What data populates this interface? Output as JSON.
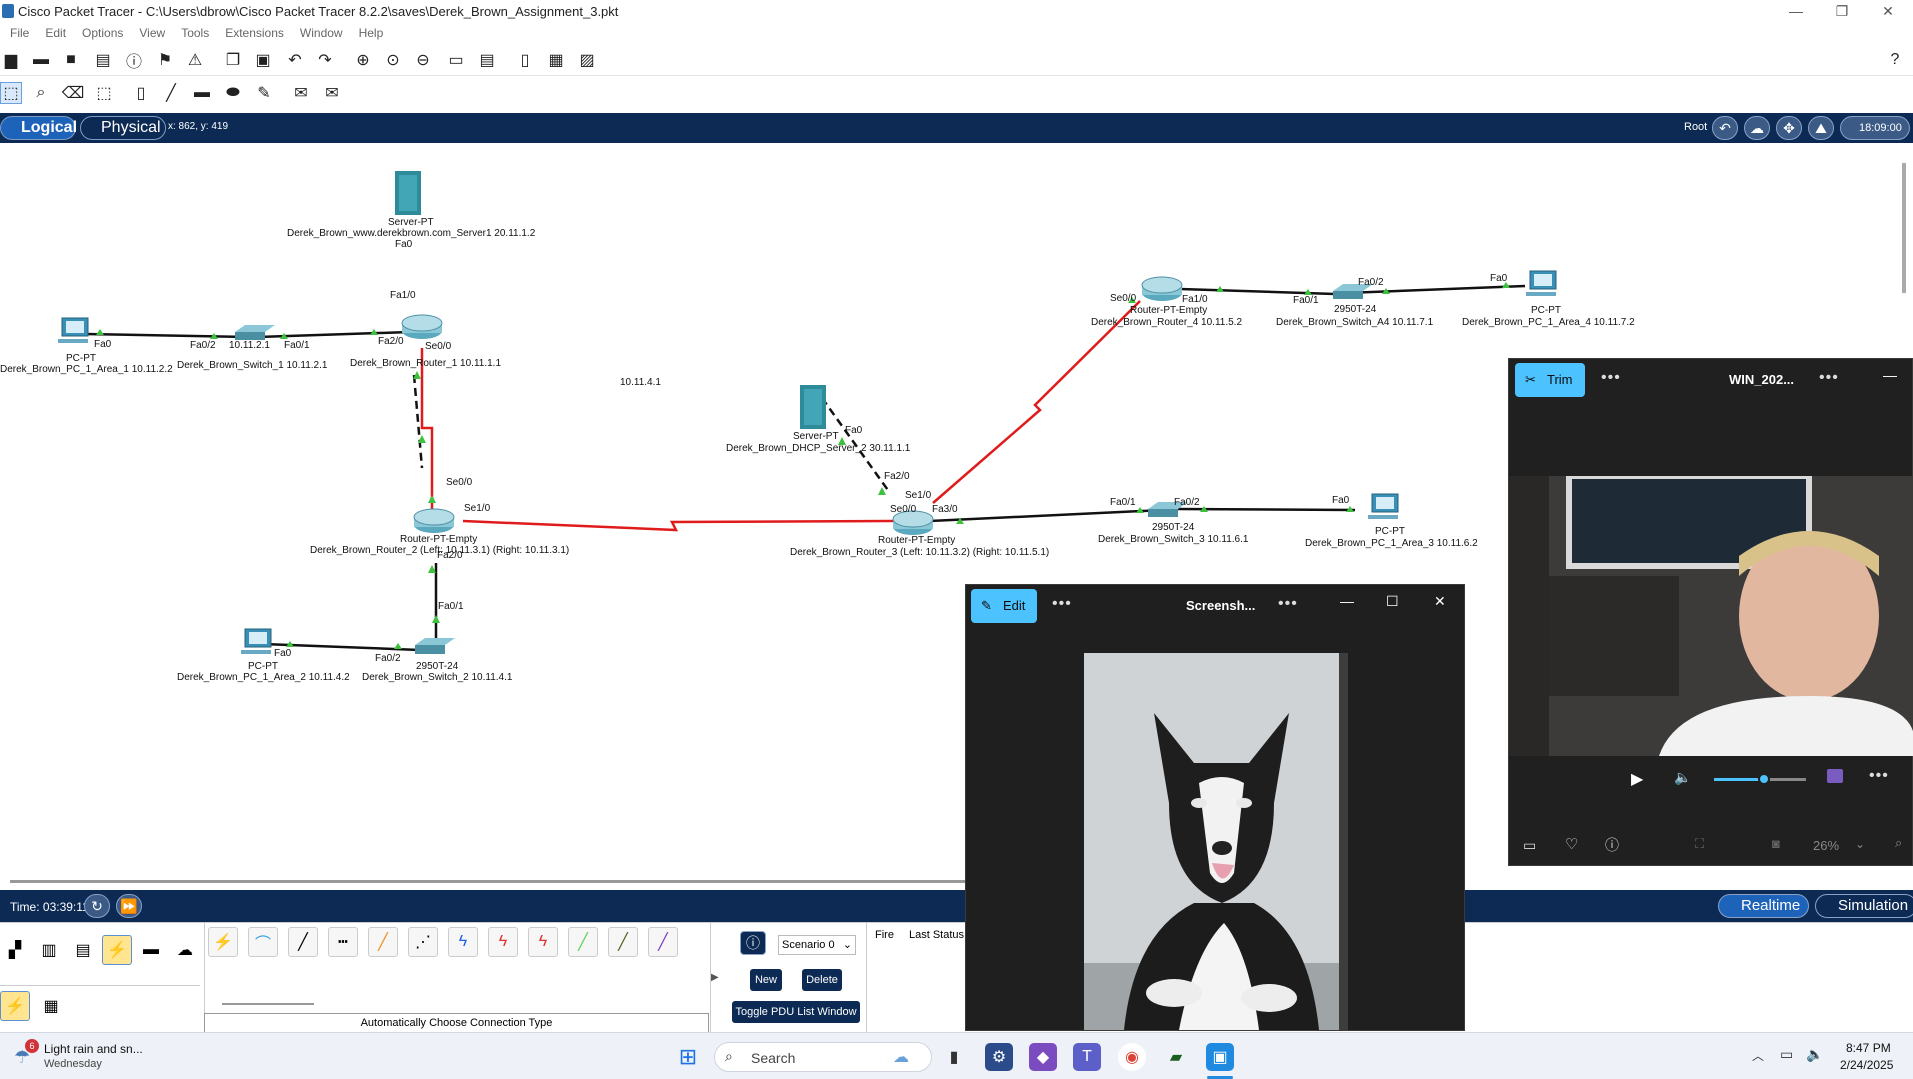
{
  "window": {
    "title": "Cisco Packet Tracer - C:\\Users\\dbrow\\Cisco Packet Tracer 8.2.2\\saves\\Derek_Brown_Assignment_3.pkt",
    "minimize": "—",
    "maximize": "❐",
    "close": "✕"
  },
  "menu": [
    "File",
    "Edit",
    "Options",
    "View",
    "Tools",
    "Extensions",
    "Window",
    "Help"
  ],
  "nav": {
    "logical": "Logical",
    "physical": "Physical",
    "coords": "x: 862, y: 419",
    "root": "Root",
    "time": "18:09:00"
  },
  "topology": {
    "free_label": "10.11.4.1",
    "devices": [
      {
        "id": "server1",
        "type": "Server-PT",
        "name": "Derek_Brown_www.derekbrown.com_Server1 20.11.1.2"
      },
      {
        "id": "router1",
        "type": "Router-PT-Empty",
        "name": "Derek_Brown_Router_1 10.11.1.1"
      },
      {
        "id": "switch1",
        "type": "2950T-24",
        "ip": "10.11.2.1",
        "name": "Derek_Brown_Switch_1 10.11.2.1"
      },
      {
        "id": "pc1",
        "type": "PC-PT",
        "name": "Derek_Brown_PC_1_Area_1 10.11.2.2"
      },
      {
        "id": "router2",
        "type": "Router-PT-Empty",
        "name": "Derek_Brown_Router_2 (Left: 10.11.3.1) (Right: 10.11.3.1)"
      },
      {
        "id": "switch2",
        "type": "2950T-24",
        "name": "Derek_Brown_Switch_2 10.11.4.1"
      },
      {
        "id": "pc2",
        "type": "PC-PT",
        "name": "Derek_Brown_PC_1_Area_2 10.11.4.2"
      },
      {
        "id": "server2",
        "type": "Server-PT",
        "name": "Derek_Brown_DHCP_Server_2 30.11.1.1"
      },
      {
        "id": "router3",
        "type": "Router-PT-Empty",
        "name": "Derek_Brown_Router_3 (Left: 10.11.3.2) (Right: 10.11.5.1)"
      },
      {
        "id": "switch3",
        "type": "2950T-24",
        "name": "Derek_Brown_Switch_3 10.11.6.1"
      },
      {
        "id": "pc3",
        "type": "PC-PT",
        "name": "Derek_Brown_PC_1_Area_3 10.11.6.2"
      },
      {
        "id": "router4",
        "type": "Router-PT-Empty",
        "name": "Derek_Brown_Router_4 10.11.5.2"
      },
      {
        "id": "switch4",
        "type": "2950T-24",
        "name": "Derek_Brown_Switch_A4 10.11.7.1"
      },
      {
        "id": "pc4",
        "type": "PC-PT",
        "name": "Derek_Brown_PC_1_Area_4 10.11.7.2"
      }
    ],
    "ports": [
      "Fa0",
      "Fa1/0",
      "Se0/0",
      "Fa2/0",
      "Fa0/1",
      "Fa0/2",
      "Se1/0",
      "Fa3/0"
    ]
  },
  "sim": {
    "time": "Time: 03:39:11",
    "realtime": "Realtime",
    "simulation": "Simulation"
  },
  "bottom": {
    "connection_type": "Automatically Choose Connection Type",
    "scenario": "Scenario 0",
    "new": "New",
    "delete": "Delete",
    "toggle_pdu": "Toggle PDU List Window",
    "fire": "Fire",
    "last_status": "Last Status"
  },
  "video_window": {
    "trim": "Trim",
    "title": "WIN_202...",
    "zoom": "26%"
  },
  "photo_window": {
    "edit": "Edit",
    "title": "Screensh..."
  },
  "taskbar": {
    "weather_badge": "6",
    "weather": "Light rain and sn...",
    "day": "Wednesday",
    "search": "Search",
    "time": "8:47 PM",
    "date": "2/24/2025"
  }
}
